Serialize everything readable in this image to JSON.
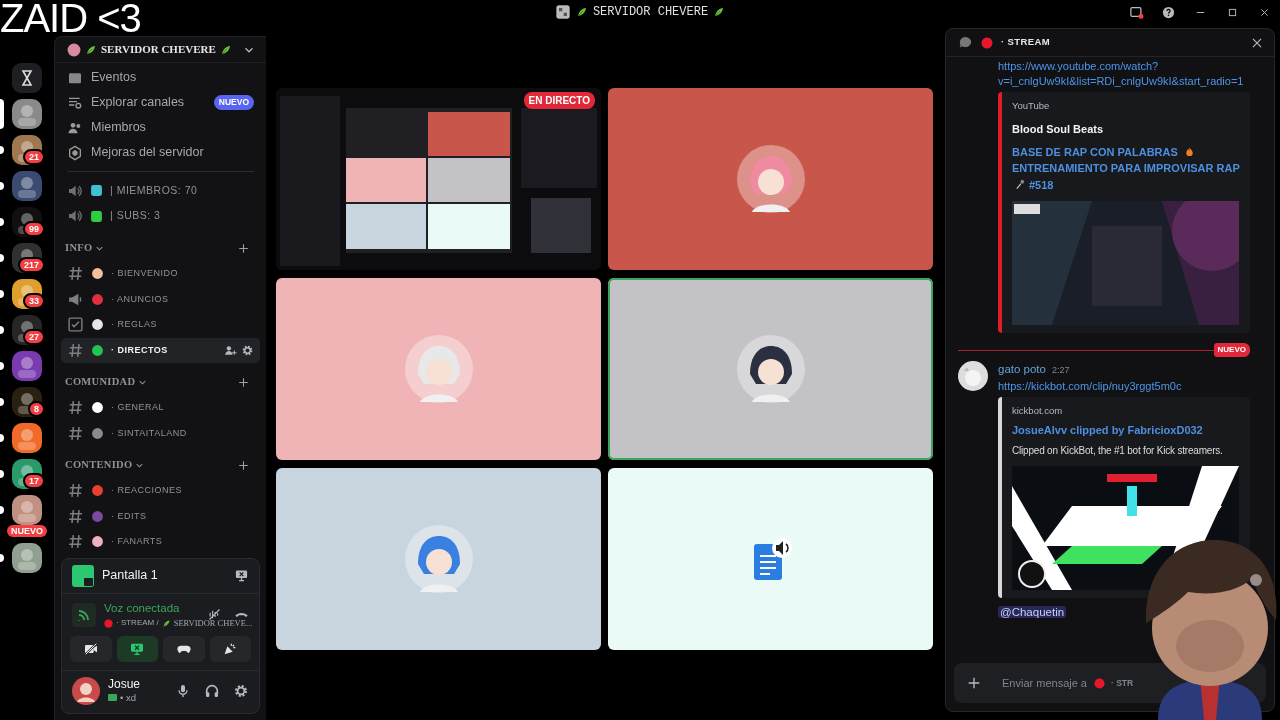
{
  "overlay": {
    "text": "ZAID <3"
  },
  "title_bar": {
    "title": "SERVIDOR CHEVERE"
  },
  "servers": [
    {
      "kind": "hourglass",
      "unread": false,
      "selected": false
    },
    {
      "kind": "server",
      "unread": false,
      "selected": true,
      "color": "#8a8a8a"
    },
    {
      "kind": "server",
      "unread": true,
      "selected": false,
      "badge": "21",
      "color": "#a07850"
    },
    {
      "kind": "server",
      "unread": true,
      "selected": false,
      "color": "#3a4a70"
    },
    {
      "kind": "server",
      "unread": true,
      "selected": false,
      "badge": "99",
      "color": "#101010"
    },
    {
      "kind": "server",
      "unread": true,
      "selected": false,
      "badge": "217",
      "color": "#303030"
    },
    {
      "kind": "server",
      "unread": true,
      "selected": false,
      "badge": "33",
      "color": "#e0a030"
    },
    {
      "kind": "server",
      "unread": true,
      "selected": false,
      "badge": "27",
      "color": "#262626"
    },
    {
      "kind": "server",
      "unread": true,
      "selected": false,
      "color": "#7a3ab0"
    },
    {
      "kind": "server",
      "unread": true,
      "selected": false,
      "badge": "8",
      "color": "#2a2010"
    },
    {
      "kind": "server",
      "unread": true,
      "selected": false,
      "color": "#f06a28"
    },
    {
      "kind": "server",
      "unread": true,
      "selected": false,
      "badge": "17",
      "color": "#2a9a6a"
    },
    {
      "kind": "server",
      "unread": true,
      "selected": false,
      "badge": "NUEVO",
      "color": "#c09080"
    },
    {
      "kind": "server",
      "unread": true,
      "selected": false,
      "color": "#90a090"
    }
  ],
  "sidebar": {
    "server_name": "SERVIDOR CHEVERE",
    "menu": [
      {
        "label": "Eventos",
        "kind": "events"
      },
      {
        "label": "Explorar canales",
        "kind": "browse",
        "badge": "NUEVO"
      },
      {
        "label": "Miembros",
        "kind": "members"
      },
      {
        "label": "Mejoras del servidor",
        "kind": "boost"
      }
    ],
    "stat_channels": [
      {
        "label": "| MIEMBROS: 70",
        "color": "#40c0d0"
      },
      {
        "label": "| SUBS: 3",
        "color": "#2ecc40"
      }
    ],
    "categories": [
      {
        "name": "INFO",
        "expanded": true,
        "channels": [
          {
            "name": "· BIENVENIDO",
            "kind": "text",
            "color": "#f0c0a0",
            "selected": false
          },
          {
            "name": "· ANUNCIOS",
            "kind": "announcement",
            "color": "#e03040",
            "selected": false
          },
          {
            "name": "· REGLAS",
            "kind": "rules",
            "color": "#e6e6e6",
            "selected": false
          },
          {
            "name": "· DIRECTOS",
            "kind": "text",
            "color": "#23c552",
            "selected": true
          }
        ]
      },
      {
        "name": "COMUNIDAD",
        "expanded": true,
        "channels": [
          {
            "name": "· GENERAL",
            "kind": "text",
            "color": "#ffffff",
            "selected": false
          },
          {
            "name": "· SINTAITALAND",
            "kind": "text",
            "color": "#8a8a8a",
            "selected": false
          }
        ]
      },
      {
        "name": "CONTENIDO",
        "expanded": true,
        "channels": [
          {
            "name": "· REACCIONES",
            "kind": "text",
            "color": "#e84030",
            "selected": false
          },
          {
            "name": "· EDITS",
            "kind": "text",
            "color": "#7a4aa0",
            "selected": false
          },
          {
            "name": "· FANARTS",
            "kind": "text",
            "color": "#f0b0c0",
            "selected": false
          }
        ]
      }
    ]
  },
  "stream_panel": {
    "title": "Pantalla 1",
    "status": "Voz conectada",
    "channel": "· STREAM /",
    "server": "SERVIDOR CHEVE...",
    "buttons": [
      {
        "kind": "camera",
        "selected": false
      },
      {
        "kind": "screen",
        "selected": true
      },
      {
        "kind": "activity",
        "selected": false
      },
      {
        "kind": "soundboard",
        "selected": false
      }
    ]
  },
  "user": {
    "name": "Josue",
    "status": "• xd"
  },
  "tiles": [
    {
      "kind": "screen",
      "live_badge": "EN DIRECTO",
      "selected": false
    },
    {
      "kind": "user",
      "color": "#c9564a",
      "selected": false
    },
    {
      "kind": "user",
      "color": "#f0b4b6",
      "selected": false
    },
    {
      "kind": "user",
      "color": "#c3c2c6",
      "selected": true
    },
    {
      "kind": "user",
      "color": "#c9d5de",
      "selected": false
    },
    {
      "kind": "bot",
      "color": "#eafaf6",
      "selected": false
    }
  ],
  "chat": {
    "channel": "· STREAM",
    "messages": [
      {
        "kind": "continuation",
        "link": "https://www.youtube.com/watch?v=i_cnlgUw9kI&list=RDi_cnlgUw9kI&start_radio=1",
        "embed": {
          "provider": "YouTube",
          "author": "Blood Soul Beats",
          "title_parts": [
            "BASE DE RAP CON PALABRAS",
            "ENTRENAMIENTO PARA IMPROVISAR RAP",
            "#518"
          ],
          "color": "#e01e2a"
        }
      },
      {
        "kind": "divider",
        "label": "NUEVO"
      },
      {
        "kind": "message",
        "author": "gato poto",
        "time": "2:27",
        "link": "https://kickbot.com/clip/nuy3rggt5m0c",
        "embed": {
          "provider": "kickbot.com",
          "title_parts": [
            "JosueAlvv clipped by FabricioxD032"
          ],
          "description": "Clipped on KickBot, the #1 bot for Kick streamers.",
          "color": "#d8d8d8"
        },
        "mention": "@Chaquetin"
      }
    ],
    "input": {
      "placeholder": "Enviar mensaje a",
      "channel": "· STR"
    }
  }
}
